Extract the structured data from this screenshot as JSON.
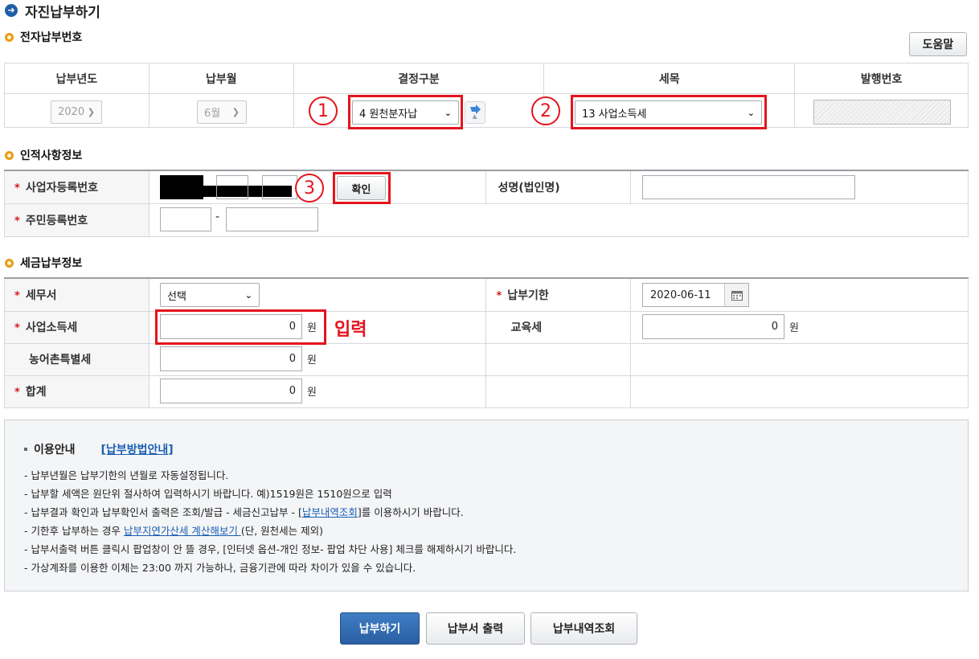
{
  "page": {
    "title": "자진납부하기",
    "help_label": "도움말"
  },
  "sections": {
    "electronic": "전자납부번호",
    "personal": "인적사항정보",
    "tax": "세금납부정보"
  },
  "electronic": {
    "headers": [
      "납부년도",
      "납부월",
      "결정구분",
      "세목",
      "발행번호"
    ],
    "year": "2020",
    "month": "6월",
    "decision": "4 원천분자납",
    "tax_item": "13 사업소득세",
    "issue_no": ""
  },
  "personal": {
    "biz_no_label": "사업자등록번호",
    "confirm_label": "확인",
    "name_label": "성명(법인명)",
    "name_value": "",
    "rrn_label": "주민등록번호",
    "rrn_dash": "-"
  },
  "tax": {
    "office_label": "세무서",
    "office_value": "선택",
    "due_label": "납부기한",
    "due_value": "2020-06-11",
    "income_tax_label": "사업소득세",
    "income_tax_value": "0",
    "edu_tax_label": "교육세",
    "edu_tax_value": "0",
    "rural_tax_label": "농어촌특별세",
    "rural_tax_value": "0",
    "total_label": "합계",
    "total_value": "0",
    "won": "원"
  },
  "annotations": {
    "n1": "1",
    "n2": "2",
    "n3": "3",
    "input_hint": "입력"
  },
  "notice": {
    "title": "이용안내",
    "guide_link": "[납부방법안내]",
    "line1": "- 납부년월은 납부기한의 년월로 자동설정됩니다.",
    "line2": "- 납부할 세액은 원단위 절사하여 입력하시기 바랍니다. 예)1519원은 1510원으로 입력",
    "line3_pre": "- 납부결과 확인과 납부확인서 출력은 조회/발급 - 세금신고납부 - [",
    "line3_link": "납부내역조회",
    "line3_post": "]를 이용하시기 바랍니다.",
    "line4_pre": "- 기한후 납부하는 경우 ",
    "line4_link": "납부지연가산세 계산해보기 ",
    "line4_post": "(단, 원천세는 제외)",
    "line5": "- 납부서출력 버튼 클릭시 팝업창이 안 뜰 경우, [인터넷 옵션-개인 정보- 팝업 차단 사용] 체크를 해제하시기 바랍니다.",
    "line6": "- 가상계좌를 이용한 이체는 23:00 까지 가능하나, 금융기관에 따라 차이가 있을 수 있습니다."
  },
  "buttons": {
    "pay": "납부하기",
    "print": "납부서 출력",
    "history": "납부내역조회"
  },
  "colors": {
    "annotation_red": "#e3141d",
    "primary_blue": "#2f6cb5",
    "section_bullet": "#e99c12"
  }
}
